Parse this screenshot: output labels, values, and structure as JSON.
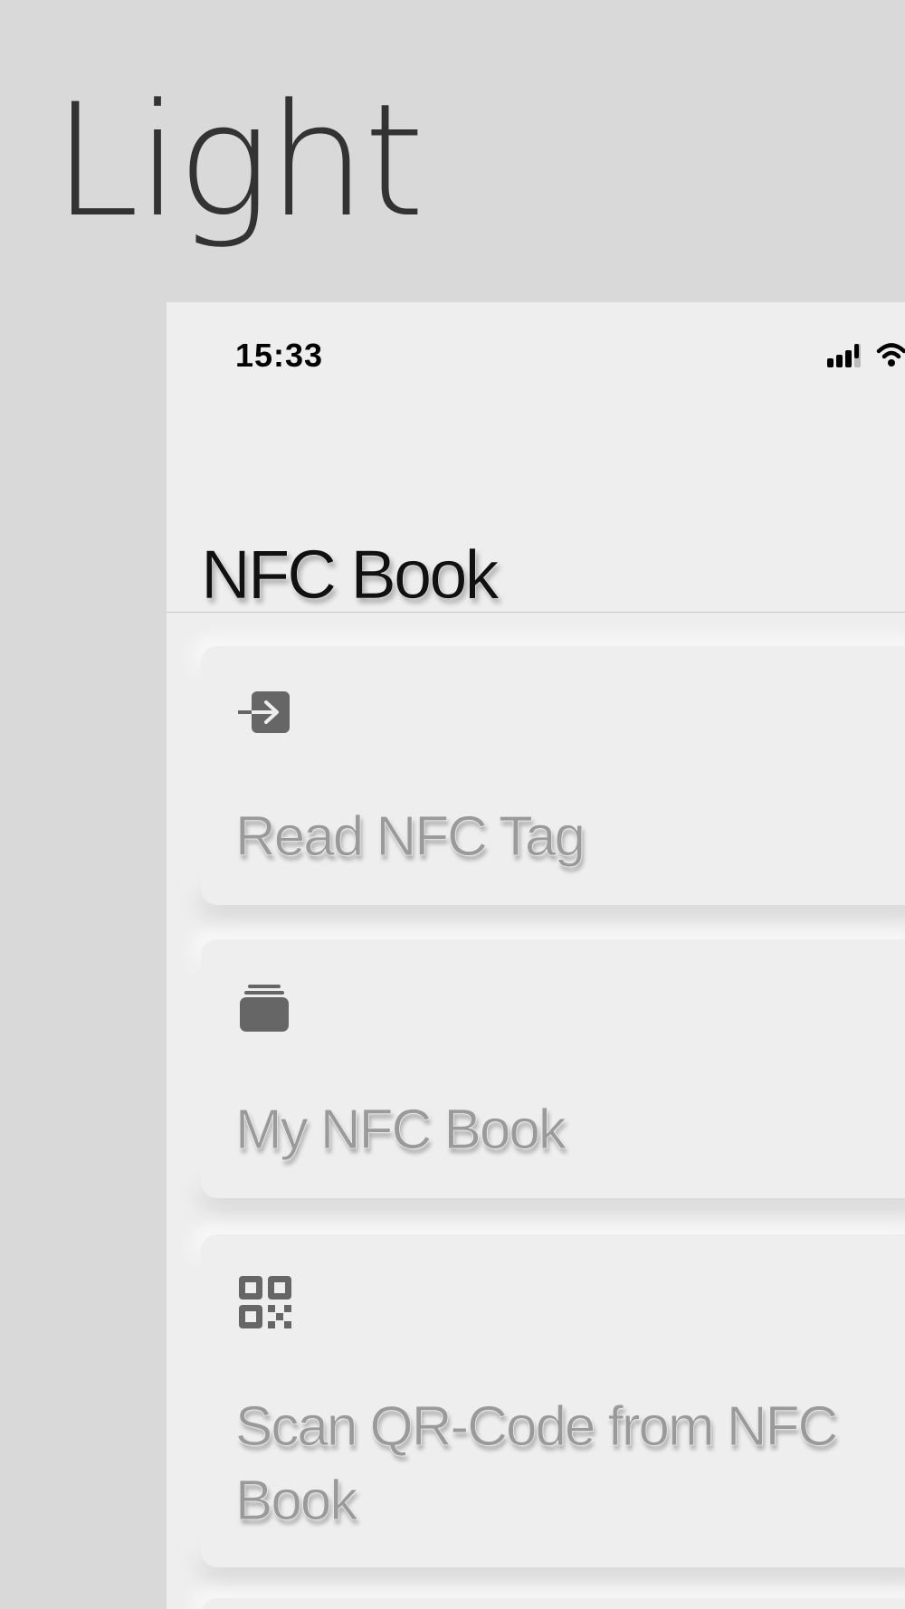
{
  "hero": {
    "title": "Light"
  },
  "status_bar": {
    "time": "15:33"
  },
  "nav": {
    "title": "NFC Book"
  },
  "menu": [
    {
      "label": "Read NFC Tag",
      "icon": "import-arrow-icon"
    },
    {
      "label": "My NFC Book",
      "icon": "stacked-folder-icon"
    },
    {
      "label": "Scan QR-Code from NFC Book",
      "icon": "qr-code-icon"
    }
  ],
  "colors": {
    "page_background": "#d9d9d9",
    "screen_background": "#eeeeee",
    "icon": "#666666",
    "label_text": "#9a9a9a"
  }
}
